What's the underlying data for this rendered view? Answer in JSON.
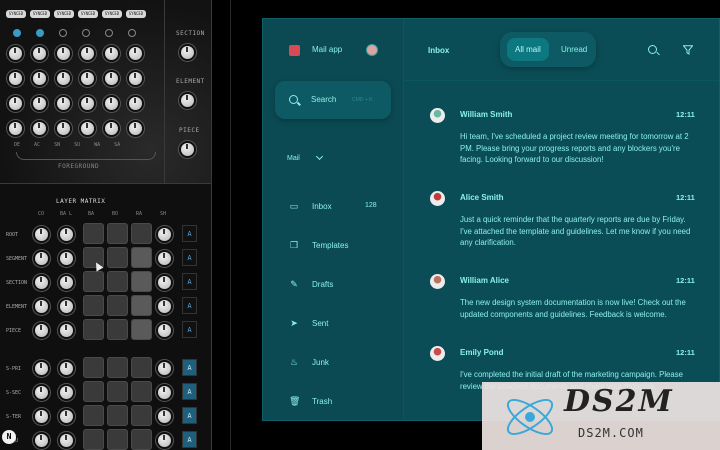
{
  "synth": {
    "sync_buttons": [
      "SYNCED",
      "SYNCED",
      "SYNCED",
      "SYNCED",
      "SYNCED",
      "SYNCED"
    ],
    "side_labels": [
      "SECTION",
      "ELEMENT",
      "PIECE"
    ],
    "bottom_labels": [
      "DE",
      "AC",
      "SN",
      "SU",
      "WA",
      "SA"
    ],
    "foreground_label": "FOREGROUND",
    "matrix_title": "LAYER MATRIX",
    "matrix_columns": [
      "CO",
      "BA L",
      "BA",
      "BO",
      "RA",
      "SH"
    ],
    "matrix_rows_top": [
      "ROOT",
      "SEGMENT",
      "SECTION",
      "ELEMENT",
      "PIECE"
    ],
    "matrix_rows_bottom": [
      "S-PRI",
      "S-SEC",
      "S-TER",
      "S-QU"
    ],
    "select_label": "A",
    "badge": "N"
  },
  "mail": {
    "app_title": "Mail app",
    "search_label": "Search",
    "search_shortcut": "CMD + K",
    "section_label": "Mail",
    "nav": [
      {
        "label": "Inbox",
        "icon": "inbox-icon",
        "count": "128"
      },
      {
        "label": "Templates",
        "icon": "templates-icon",
        "count": ""
      },
      {
        "label": "Drafts",
        "icon": "drafts-icon",
        "count": ""
      },
      {
        "label": "Sent",
        "icon": "sent-icon",
        "count": ""
      },
      {
        "label": "Junk",
        "icon": "junk-icon",
        "count": ""
      },
      {
        "label": "Trash",
        "icon": "trash-icon",
        "count": ""
      }
    ],
    "list_title": "Inbox",
    "filter_all": "All mail",
    "filter_unread": "Unread",
    "messages": [
      {
        "name": "William Smith",
        "time": "12:11",
        "body": "Hi team, I've scheduled a project review meeting for tomorrow at 2 PM. Please bring your progress reports and any blockers you're facing. Looking forward to our discussion!"
      },
      {
        "name": "Alice Smith",
        "time": "12:11",
        "body": "Just a quick reminder that the quarterly reports are due by Friday. I've attached the template and guidelines. Let me know if you need any clarification."
      },
      {
        "name": "William Alice",
        "time": "12:11",
        "body": "The new design system documentation is now live! Check out the updated components and guidelines. Feedback is welcome."
      },
      {
        "name": "Emily Pond",
        "time": "12:11",
        "body": "I've completed the initial draft of the marketing campaign. Please review the attached documents and share your thoughts."
      }
    ],
    "colors": {
      "panel": "#0b4d56",
      "accent": "#8af0e8",
      "logo": "#d94a57"
    }
  },
  "watermark": {
    "title": "DS2M",
    "subtitle": "DS2M.COM"
  }
}
